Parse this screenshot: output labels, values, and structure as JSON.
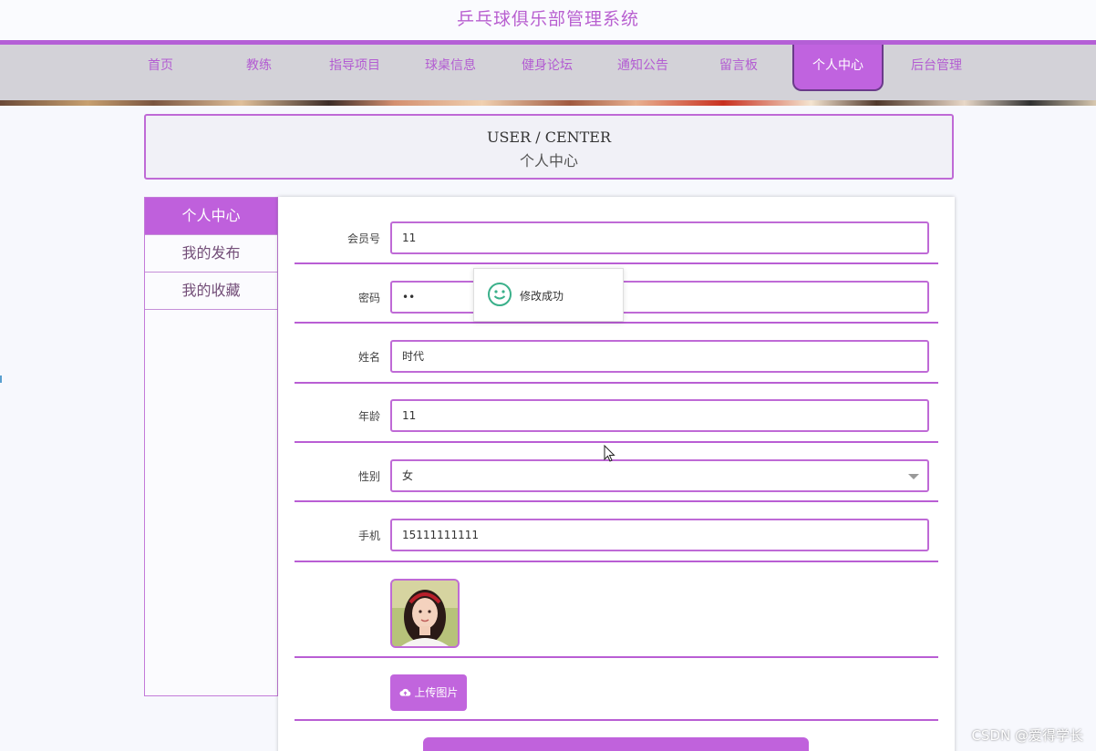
{
  "site": {
    "title": "乒乓球俱乐部管理系统"
  },
  "nav": {
    "items": [
      {
        "label": "首页"
      },
      {
        "label": "教练"
      },
      {
        "label": "指导项目"
      },
      {
        "label": "球桌信息"
      },
      {
        "label": "健身论坛"
      },
      {
        "label": "通知公告"
      },
      {
        "label": "留言板"
      },
      {
        "label": "个人中心",
        "active": true
      },
      {
        "label": "后台管理"
      }
    ]
  },
  "header": {
    "en": "USER / CENTER",
    "cn": "个人中心"
  },
  "sidebar": {
    "items": [
      {
        "label": "个人中心",
        "active": true
      },
      {
        "label": "我的发布"
      },
      {
        "label": "我的收藏"
      }
    ]
  },
  "form": {
    "member_no": {
      "label": "会员号",
      "value": "11"
    },
    "password": {
      "label": "密码",
      "value": "••"
    },
    "name": {
      "label": "姓名",
      "value": "时代"
    },
    "age": {
      "label": "年龄",
      "value": "11"
    },
    "gender": {
      "label": "性别",
      "value": "女"
    },
    "phone": {
      "label": "手机",
      "value": "15111111111"
    },
    "upload_label": "上传图片"
  },
  "toast": {
    "message": "修改成功"
  },
  "watermark": "CSDN @爱得学长",
  "colors": {
    "accent": "#c062dc",
    "nav_bg": "#d3d2d8",
    "border": "#bf6ad6"
  }
}
